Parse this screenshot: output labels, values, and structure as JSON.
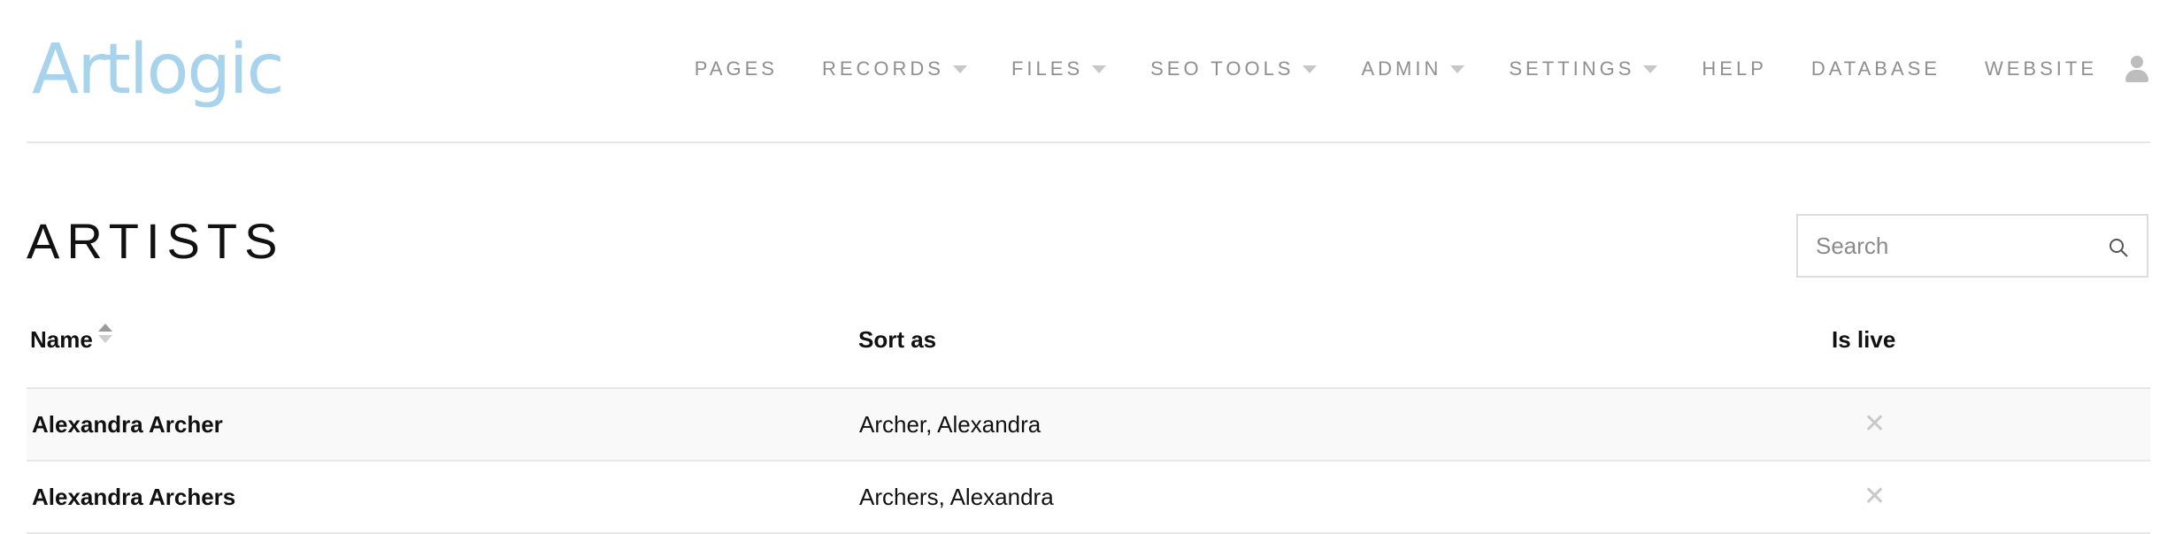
{
  "brand": {
    "logo_text": "Artlogic",
    "logo_color": "#a8d3ec"
  },
  "nav": {
    "items": [
      {
        "label": "PAGES",
        "has_dropdown": false
      },
      {
        "label": "RECORDS",
        "has_dropdown": true
      },
      {
        "label": "FILES",
        "has_dropdown": true
      },
      {
        "label": "SEO TOOLS",
        "has_dropdown": true
      },
      {
        "label": "ADMIN",
        "has_dropdown": true
      },
      {
        "label": "SETTINGS",
        "has_dropdown": true
      },
      {
        "label": "HELP",
        "has_dropdown": false
      },
      {
        "label": "DATABASE",
        "has_dropdown": false
      },
      {
        "label": "WEBSITE",
        "has_dropdown": false
      }
    ],
    "user_icon": "user-icon"
  },
  "page": {
    "title": "ARTISTS"
  },
  "search": {
    "placeholder": "Search",
    "value": "",
    "icon": "search-icon"
  },
  "table": {
    "columns": {
      "name": "Name",
      "sort_as": "Sort as",
      "is_live": "Is live"
    },
    "sort_column": "Name",
    "rows": [
      {
        "name": "Alexandra Archer",
        "sort_as": "Archer, Alexandra",
        "is_live": "✕"
      },
      {
        "name": "Alexandra Archers",
        "sort_as": "Archers, Alexandra",
        "is_live": "✕"
      }
    ]
  }
}
